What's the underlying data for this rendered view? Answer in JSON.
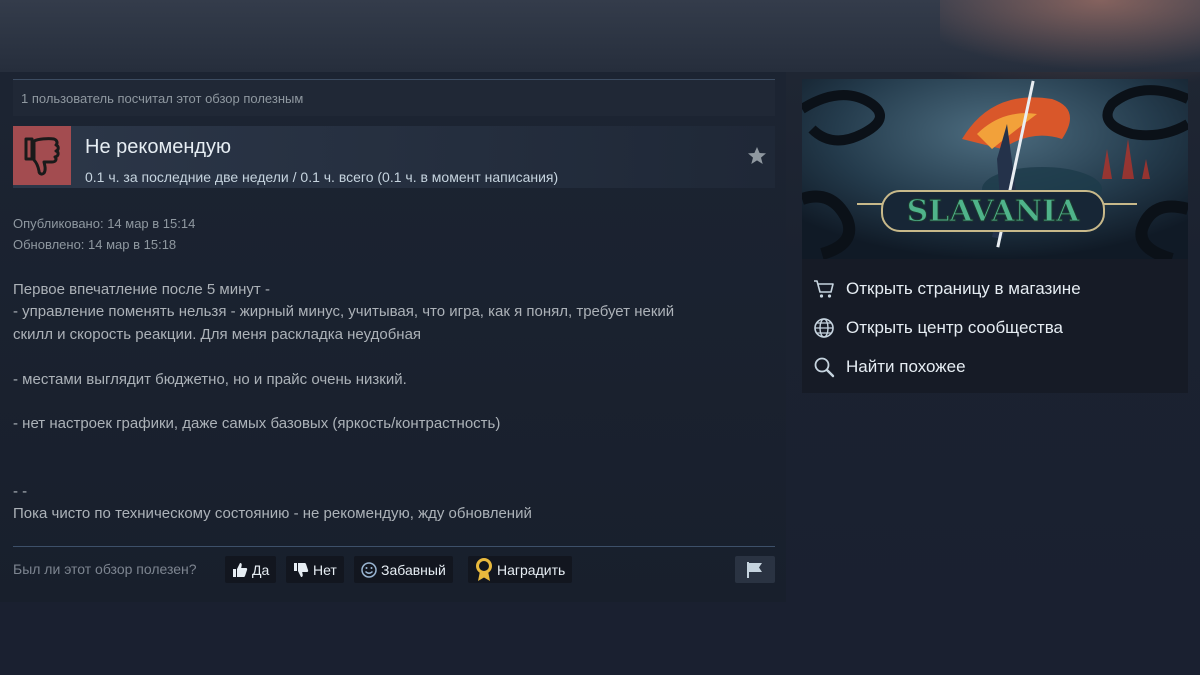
{
  "review": {
    "helpful_count_text": "1 пользователь посчитал этот обзор полезным",
    "verdict": "Не рекомендую",
    "hours": "0.1 ч. за последние две недели / 0.1 ч. всего (0.1 ч. в момент написания)",
    "posted": "Опубликовано: 14 мар в 15:14",
    "updated": "Обновлено: 14 мар в 15:18",
    "body_lines": [
      "Первое впечатление после 5 минут -",
      "- управление поменять нельзя - жирный минус, учитывая, что игра, как я понял, требует некий",
      "скилл и скорость реакции. Для меня раскладка неудобная",
      "",
      "- местами выглядит бюджетно, но и прайс очень низкий.",
      "",
      "- нет настроек графики, даже самых базовых (яркость/контрастность)",
      "",
      "",
      "- -",
      "Пока чисто по техническому состоянию - не рекомендую, жду обновлений"
    ]
  },
  "vote": {
    "question": "Был ли этот обзор полезен?",
    "yes": "Да",
    "no": "Нет",
    "funny": "Забавный",
    "award": "Наградить"
  },
  "game": {
    "logo_text": "SLAVANIA",
    "links": [
      {
        "label": "Открыть страницу в магазине",
        "icon": "cart-icon"
      },
      {
        "label": "Открыть центр сообщества",
        "icon": "globe-icon"
      },
      {
        "label": "Найти похожее",
        "icon": "search-icon"
      }
    ]
  },
  "colors": {
    "thumb_down_bg": "#a34c50",
    "award_gold": "#e8b93d"
  }
}
